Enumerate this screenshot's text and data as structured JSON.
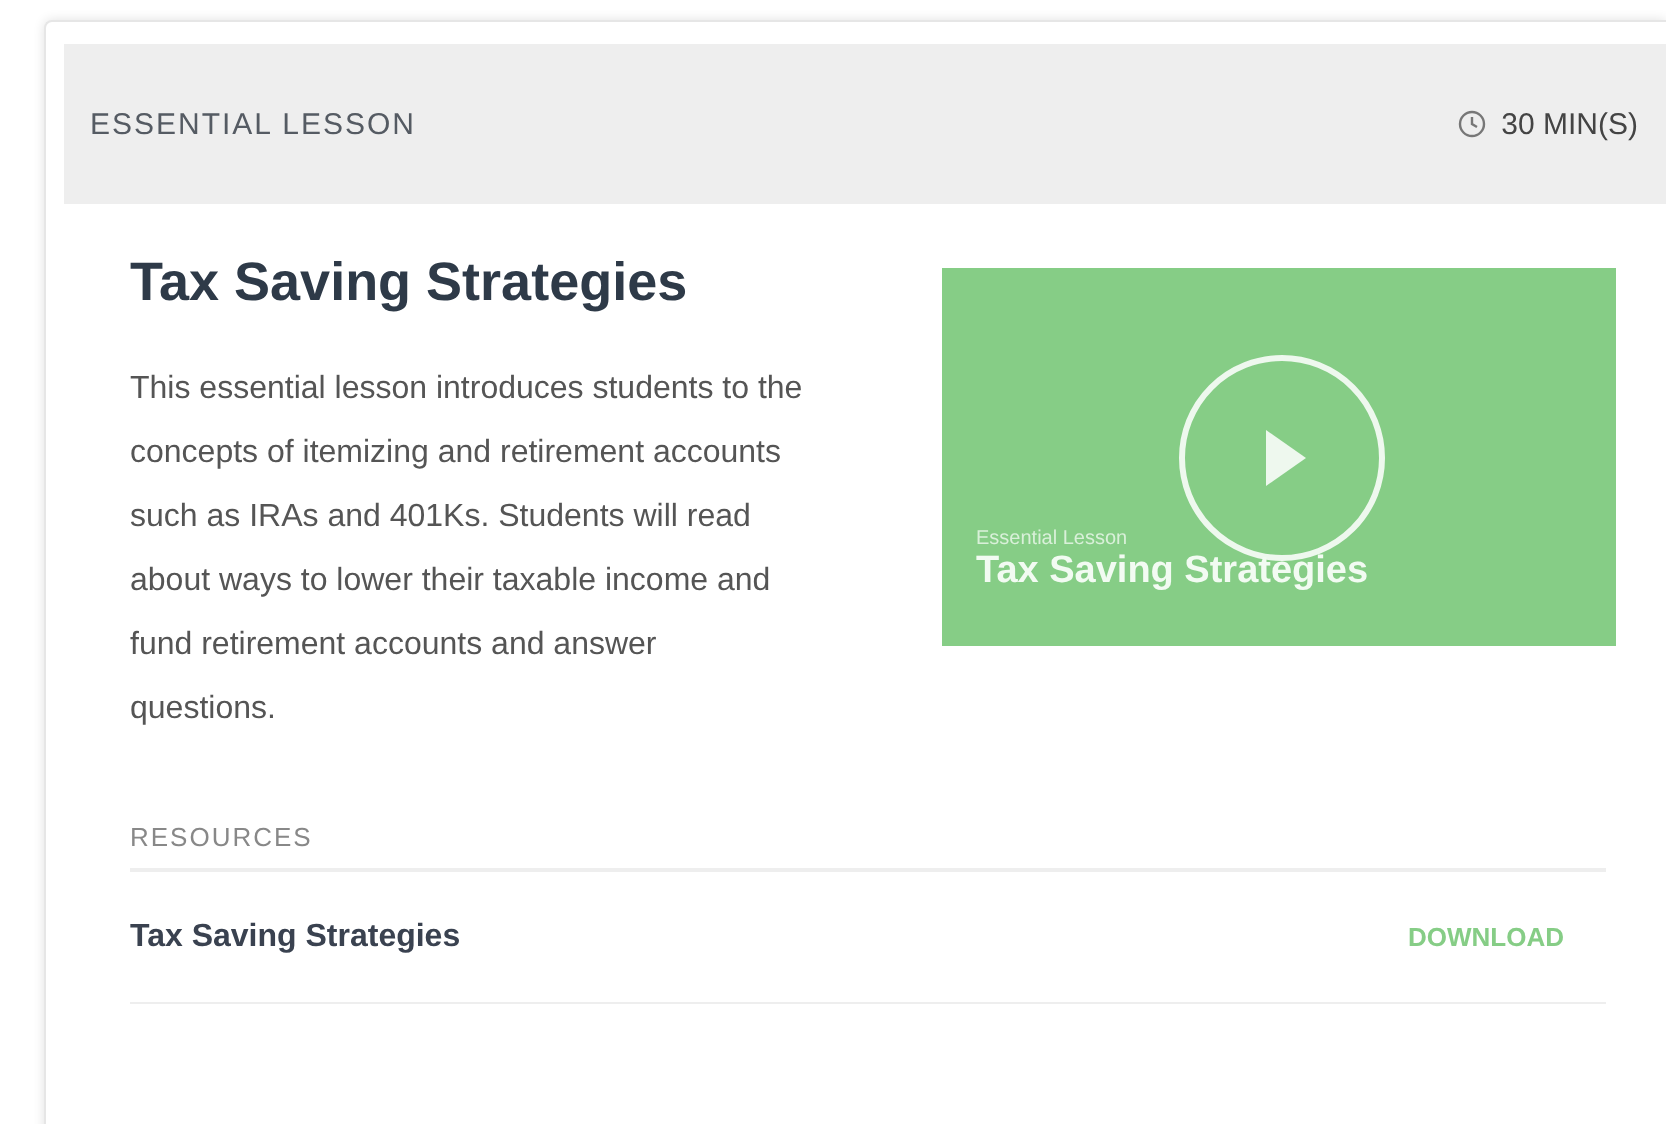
{
  "header": {
    "label": "ESSENTIAL LESSON",
    "duration": "30 MIN(S)"
  },
  "lesson": {
    "title": "Tax Saving Strategies",
    "description": "This essential lesson introduces students to the concepts of itemizing and retirement accounts such as IRAs and 401Ks. Students will read about ways to lower their taxable income and fund retirement accounts and answer questions."
  },
  "video": {
    "caption": "Essential Lesson",
    "title": "Tax Saving Strategies"
  },
  "resources": {
    "heading": "RESOURCES",
    "items": [
      {
        "name": "Tax Saving Strategies",
        "action": "DOWNLOAD"
      }
    ]
  }
}
